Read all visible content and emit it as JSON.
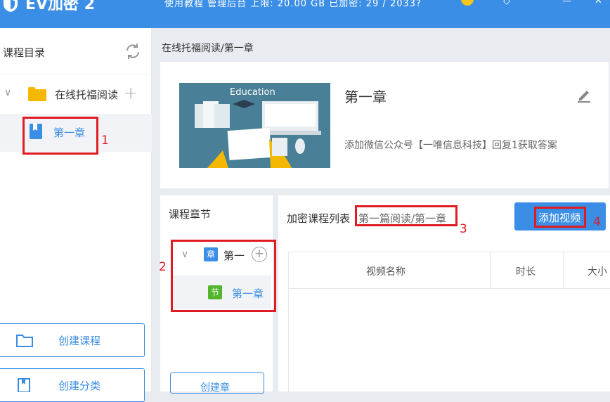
{
  "app": {
    "title": "EV加密 2",
    "top_info": "使用教程   管理后台   上限: 20.00 GB   已加密: 29 / 2033?",
    "minimize_label": "—",
    "close_label": "✕"
  },
  "sidebar": {
    "title": "课程目录",
    "tree": {
      "root_label": "在线托福阅读",
      "child_label": "第一章"
    },
    "buttons": [
      {
        "label": "创建课程",
        "icon": "folder-icon"
      },
      {
        "label": "创建分类",
        "icon": "book-icon"
      }
    ]
  },
  "breadcrumb": "在线托福阅读/第一章",
  "course": {
    "title": "第一章",
    "description": "添加微信公众号【一唯信息科技】回复1获取答案",
    "thumbnail_text": "Education"
  },
  "chapters": {
    "title": "课程章节",
    "chapter_badge": "章",
    "chapter_label": "第一",
    "section_badge": "节",
    "section_label": "第一章",
    "create_label": "创建章"
  },
  "videos": {
    "title": "加密课程列表",
    "path": "第一篇阅读/第一章",
    "add_button_label": "添加视频",
    "columns": [
      "视频名称",
      "时长",
      "大小"
    ]
  },
  "annotations": [
    "1",
    "2",
    "3",
    "4"
  ],
  "colors": {
    "accent": "#3a8ee6",
    "highlight_box": "#e01b22",
    "folder": "#f5b800",
    "chapter_badge": "#3a8ee6",
    "section_badge": "#52b52c"
  }
}
